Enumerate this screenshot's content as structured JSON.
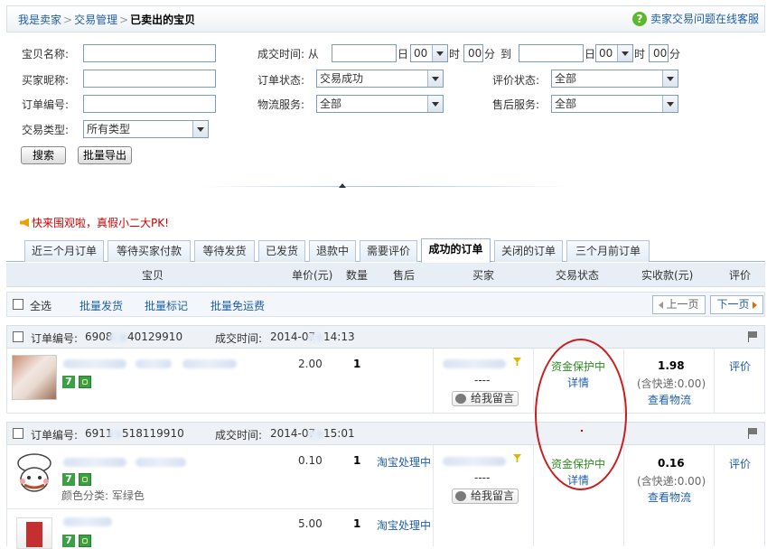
{
  "breadcrumb": {
    "items": [
      "我是卖家",
      "交易管理"
    ],
    "current": "已卖出的宝贝",
    "help_text": "卖家交易问题在线客服",
    "help_icon": "question-icon"
  },
  "search_form": {
    "item_name_label": "宝贝名称:",
    "buyer_nick_label": "买家昵称:",
    "order_no_label": "订单编号:",
    "trade_type_label": "交易类型:",
    "trade_type_value": "所有类型",
    "deal_time_label": "成交时间: 从",
    "day_char": "日",
    "hour_value": "00",
    "hour_char": "时",
    "minute_value": "00",
    "minute_char": "分",
    "to_char": "到",
    "order_status_label": "订单状态:",
    "order_status_value": "交易成功",
    "logistics_label": "物流服务:",
    "logistics_value": "全部",
    "review_status_label": "评价状态:",
    "review_status_value": "全部",
    "after_sale_label": "售后服务:",
    "after_sale_value": "全部",
    "search_button": "搜索",
    "export_button": "批量导出"
  },
  "promo": {
    "text": "快来围观啦，真假小二大PK!"
  },
  "tabs": [
    "近三个月订单",
    "等待买家付款",
    "等待发货",
    "已发货",
    "退款中",
    "需要评价",
    "成功的订单",
    "关闭的订单",
    "三个月前订单"
  ],
  "active_tab": "成功的订单",
  "columns": {
    "item": "宝贝",
    "unit_price": "单价(元)",
    "quantity": "数量",
    "after_sale": "售后",
    "buyer": "买家",
    "status": "交易状态",
    "paid": "实收款(元)",
    "review": "评价"
  },
  "bulk": {
    "select_all": "全选",
    "batch_ship": "批量发货",
    "batch_mark": "批量标记",
    "batch_free_ship": "批量免运费",
    "prev_page": "上一页",
    "next_page": "下一页"
  },
  "orders": [
    {
      "order_no_label": "订单编号:",
      "order_no_prefix": "6908",
      "order_no_suffix": "40129910",
      "deal_time_label": "成交时间:",
      "deal_time_prefix": "2014-07",
      "deal_time_suffix": "14:13",
      "items": [
        {
          "price": "2.00",
          "qty": "1",
          "after_sale": ""
        }
      ],
      "buyer_dash": "----",
      "leave_msg": "给我留言",
      "status": "资金保护中",
      "detail": "详情",
      "paid": "1.98",
      "shipping": "(含快递:0.00)",
      "logistics": "查看物流",
      "review": "评价"
    },
    {
      "order_no_label": "订单编号:",
      "order_no_prefix": "6911",
      "order_no_suffix": "518119910",
      "deal_time_label": "成交时间:",
      "deal_time_prefix": "2014-07",
      "deal_time_suffix": "15:01",
      "items": [
        {
          "price": "0.10",
          "qty": "1",
          "after_sale": "淘宝处理中",
          "sku": "颜色分类: 军绿色"
        },
        {
          "price": "5.00",
          "qty": "1",
          "after_sale": "淘宝处理中"
        }
      ],
      "buyer_dash": "----",
      "leave_msg": "给我留言",
      "status": "资金保护中",
      "detail": "详情",
      "paid": "0.16",
      "shipping": "(含快递:0.00)",
      "logistics": "查看物流",
      "review": "评价"
    }
  ],
  "colors": {
    "link": "#1f5ea8",
    "status_green": "#2d8a1f",
    "annotation_red": "#c81e1e",
    "promo_red": "#cc0000"
  }
}
